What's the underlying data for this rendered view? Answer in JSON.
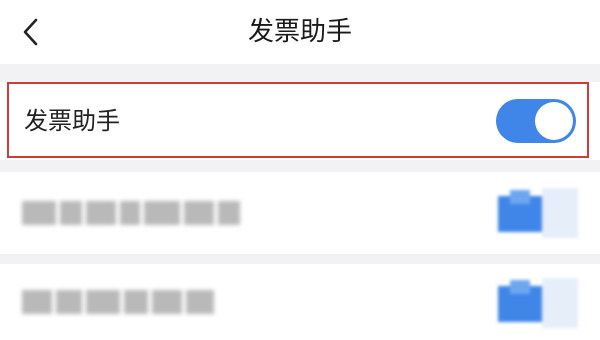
{
  "navbar": {
    "title": "发票助手",
    "back_icon": "chevron-left-icon"
  },
  "setting": {
    "label": "发票助手",
    "toggle_state": "on",
    "toggle_color": "#3f86e8",
    "highlight_color": "#d23a3a"
  },
  "blurred_rows": [
    {
      "toggle_state": "on"
    },
    {
      "toggle_state": "on"
    }
  ]
}
